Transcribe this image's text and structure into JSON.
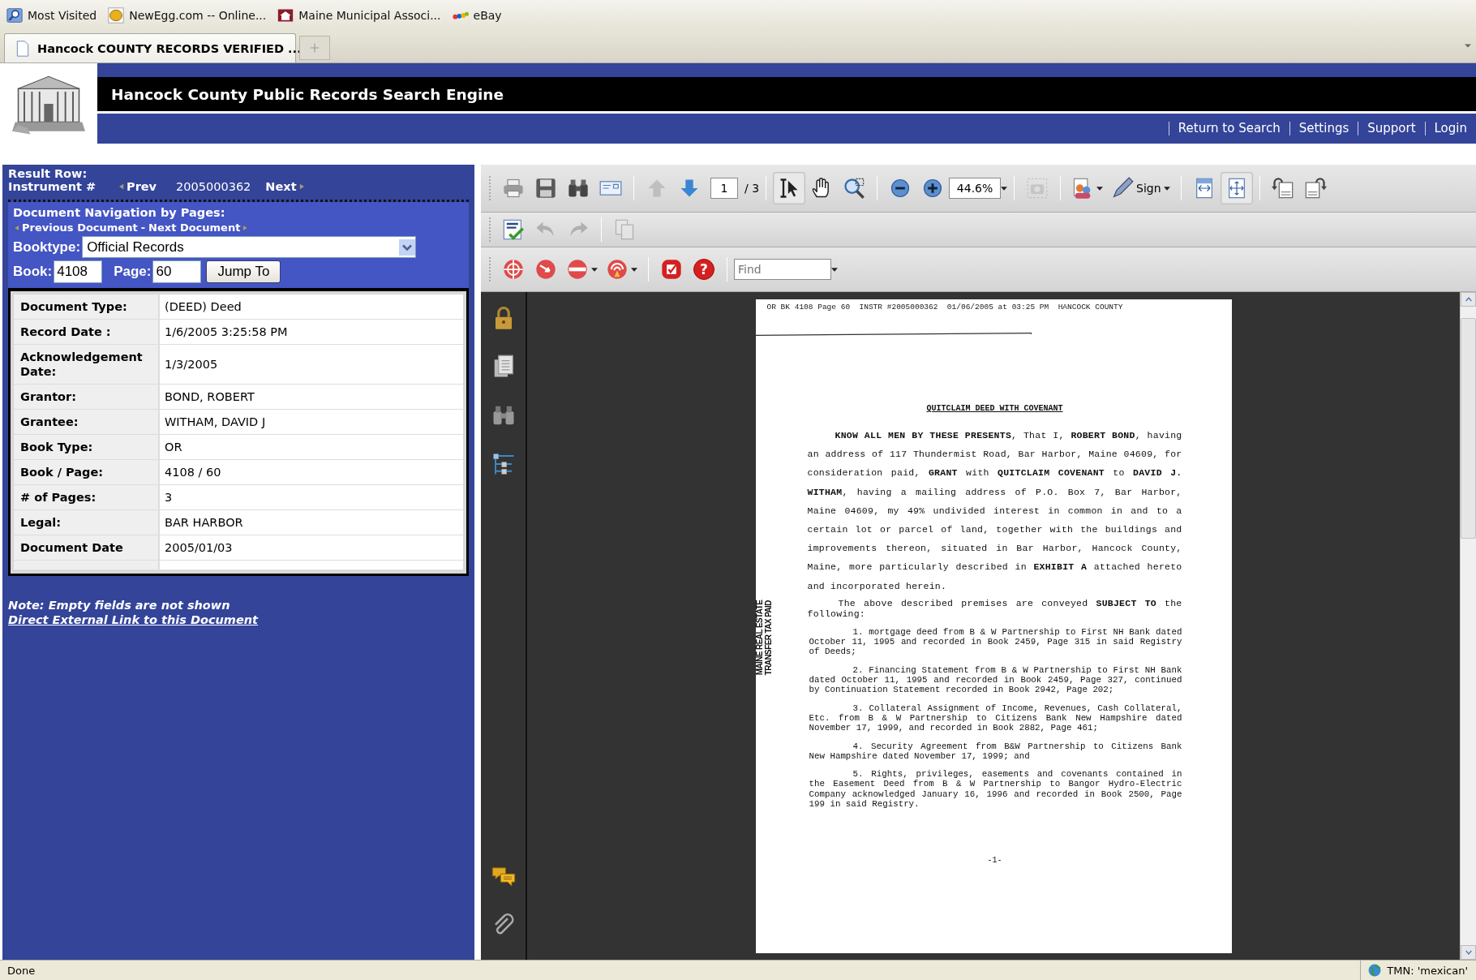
{
  "browser": {
    "bookmarks": [
      {
        "kind": "magnifier",
        "label": "Most Visited"
      },
      {
        "kind": "egg",
        "label": "NewEgg.com -- Online..."
      },
      {
        "kind": "building",
        "label": "Maine Municipal Associ..."
      },
      {
        "kind": "colors",
        "label": "eBay"
      }
    ],
    "tab": {
      "title": "Hancock COUNTY RECORDS VERIFIED ..."
    }
  },
  "site": {
    "title": "Hancock County Public Records Search Engine",
    "nav": [
      "Return to Search",
      "Settings",
      "Support",
      "Login"
    ]
  },
  "result_panel": {
    "result_row_label": "Result Row:",
    "instrument_label": "Instrument #",
    "prev": "Prev",
    "instrument": "2005000362",
    "next": "Next",
    "nav_heading": "Document Navigation by Pages:",
    "previous_document": "Previous Document",
    "separator": "-",
    "next_document": "Next Document",
    "booktype_label": "Booktype:",
    "booktype": "Official Records",
    "book_label": "Book:",
    "book": "4108",
    "page_label": "Page:",
    "page": "60",
    "jump_button": "Jump To"
  },
  "details": [
    {
      "label": "Document Type:",
      "value": "(DEED) Deed"
    },
    {
      "label": "Record Date :",
      "value": "1/6/2005 3:25:58 PM"
    },
    {
      "label": "Acknowledgement Date:",
      "value": "1/3/2005"
    },
    {
      "label": "Grantor:",
      "value": "BOND, ROBERT"
    },
    {
      "label": "Grantee:",
      "value": "WITHAM, DAVID J"
    },
    {
      "label": "Book Type:",
      "value": "OR"
    },
    {
      "label": "Book / Page:",
      "value": "4108 / 60"
    },
    {
      "label": "# of Pages:",
      "value": "3"
    },
    {
      "label": "Legal:",
      "value": "BAR HARBOR"
    },
    {
      "label": "Document Date",
      "value": "2005/01/03"
    }
  ],
  "note": "Note: Empty fields are not shown",
  "external_link": "Direct External Link to this Document",
  "viewer": {
    "toolbar_rows": [
      [
        [
          {
            "kind": "print",
            "disabled": false,
            "selected": false
          },
          {
            "kind": "save",
            "disabled": false,
            "selected": false
          },
          {
            "kind": "binoculars",
            "disabled": false,
            "selected": false
          },
          {
            "kind": "email",
            "disabled": false,
            "selected": false
          }
        ],
        [
          {
            "kind": "prev_page",
            "disabled": true,
            "selected": false
          },
          {
            "kind": "next_page",
            "disabled": false,
            "selected": false
          },
          {
            "kind": "page_field",
            "value": "1",
            "total": "/ 3"
          }
        ],
        [
          {
            "kind": "select",
            "disabled": false,
            "selected": true
          },
          {
            "kind": "hand",
            "disabled": false,
            "selected": false
          },
          {
            "kind": "marquee_zoom",
            "disabled": false,
            "selected": false
          }
        ],
        [
          {
            "kind": "zoom_out",
            "disabled": false,
            "selected": false
          },
          {
            "kind": "zoom_in",
            "disabled": false,
            "selected": false
          },
          {
            "kind": "zoom_field",
            "value": "44.6%"
          }
        ],
        [
          {
            "kind": "snapshot",
            "disabled": true,
            "selected": false
          }
        ],
        [
          {
            "kind": "share",
            "disabled": false,
            "selected": false
          },
          {
            "kind": "sign",
            "label": "Sign",
            "disabled": false,
            "selected": false
          }
        ],
        [
          {
            "kind": "fit_width",
            "disabled": false,
            "selected": false
          },
          {
            "kind": "fit_page",
            "disabled": false,
            "selected": true
          }
        ],
        [
          {
            "kind": "rotate_left",
            "disabled": false,
            "selected": false
          },
          {
            "kind": "rotate_right",
            "disabled": false,
            "selected": false
          }
        ]
      ],
      [
        [
          {
            "kind": "spell_check",
            "disabled": false
          },
          {
            "kind": "undo",
            "disabled": true,
            "selected": false
          },
          {
            "kind": "redo",
            "disabled": true,
            "selected": false
          }
        ],
        [
          {
            "kind": "copy",
            "disabled": true,
            "selected": false
          }
        ]
      ],
      [
        [
          {
            "kind": "target",
            "disabled": false,
            "selected": false
          },
          {
            "kind": "arrow_circle",
            "disabled": false,
            "selected": false
          },
          {
            "kind": "strike",
            "disabled": false,
            "selected": false
          },
          {
            "kind": "signal",
            "disabled": false,
            "selected": false
          }
        ],
        [
          {
            "kind": "stop_square",
            "disabled": false
          },
          {
            "kind": "help",
            "glyph": "?",
            "disabled": false
          }
        ],
        [
          {
            "kind": "find_field",
            "placeholder": "Find"
          }
        ]
      ]
    ],
    "side_tools": [
      {
        "kind": "lock"
      },
      {
        "kind": "pages"
      },
      {
        "kind": "binoculars"
      },
      {
        "kind": "tree"
      },
      {
        "kind": "comments"
      },
      {
        "kind": "paperclip"
      }
    ],
    "document": {
      "header": "OR BK 4108 Page 60  INSTR #2005000362  01/06/2005 at 03:25 PM  HANCOCK COUNTY",
      "title": "QUITCLAIM DEED WITH COVENANT",
      "paragraphs": [
        "**KNOW ALL MEN BY THESE PRESENTS**, That I, **ROBERT BOND**, having an address of 117 Thundermist Road, Bar Harbor, Maine 04609, for consideration paid, **GRANT** with **QUITCLAIM COVENANT** to **DAVID J. WITHAM**, having a mailing address of P.O. Box 7, Bar Harbor, Maine 04609, my 49% undivided interest in common in and to a certain lot or parcel of land, together with the buildings and improvements thereon, situated in Bar Harbor, Hancock County, Maine, more particularly described in **EXHIBIT A** attached hereto and incorporated herein.",
        "The above described premises are conveyed **SUBJECT TO** the following:"
      ],
      "items": [
        "1.  mortgage deed from B & W Partnership to First NH Bank dated October 11, 1995 and recorded in Book 2459, Page 315 in said Registry of Deeds;",
        "2.  Financing Statement from B & W Partnership to First NH Bank dated October 11, 1995 and recorded in Book 2459, Page 327, continued by Continuation Statement recorded in Book 2942, Page 202;",
        "3.  Collateral Assignment of Income, Revenues, Cash Collateral, Etc. from B & W Partnership to Citizens Bank New Hampshire dated November 17, 1999, and recorded in Book 2882, Page 461;",
        "4.  Security Agreement from B&W Partnership to Citizens Bank New Hampshire dated November 17, 1999; and",
        "5.  Rights, privileges, easements and covenants contained in the Easement Deed from B & W Partnership to Bangor Hydro-Electric Company acknowledged January 16, 1996 and recorded in Book 2500, Page 199 in said Registry."
      ],
      "page_number": "-1-",
      "stamp": [
        "MAINE REAL ESTATE",
        "TRANSFER TAX PAID"
      ]
    }
  },
  "status_bar": {
    "text": "Done",
    "right": "TMN: 'mexican'"
  }
}
